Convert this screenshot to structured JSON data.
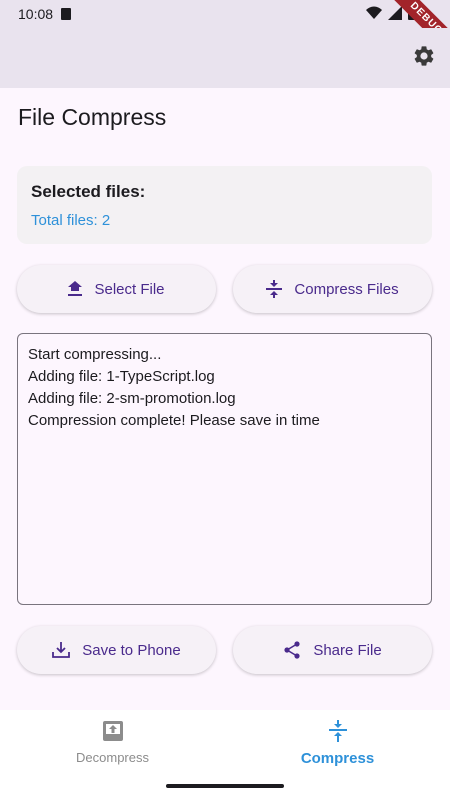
{
  "status_bar": {
    "time": "10:08",
    "debug_label": "DEBUG"
  },
  "page": {
    "title": "File Compress"
  },
  "selected": {
    "heading": "Selected files:",
    "total": "Total files: 2"
  },
  "actions": {
    "select_file": "Select File",
    "compress_files": "Compress Files",
    "save_to_phone": "Save to Phone",
    "share_file": "Share File"
  },
  "log": {
    "lines": [
      "Start compressing...",
      "Adding file: 1-TypeScript.log",
      "Adding file: 2-sm-promotion.log",
      "Compression complete! Please save in time"
    ]
  },
  "nav": {
    "decompress": "Decompress",
    "compress": "Compress"
  },
  "colors": {
    "accent": "#2e91d9",
    "button_text": "#4a2a8c",
    "appbar": "#e9e3ee"
  }
}
